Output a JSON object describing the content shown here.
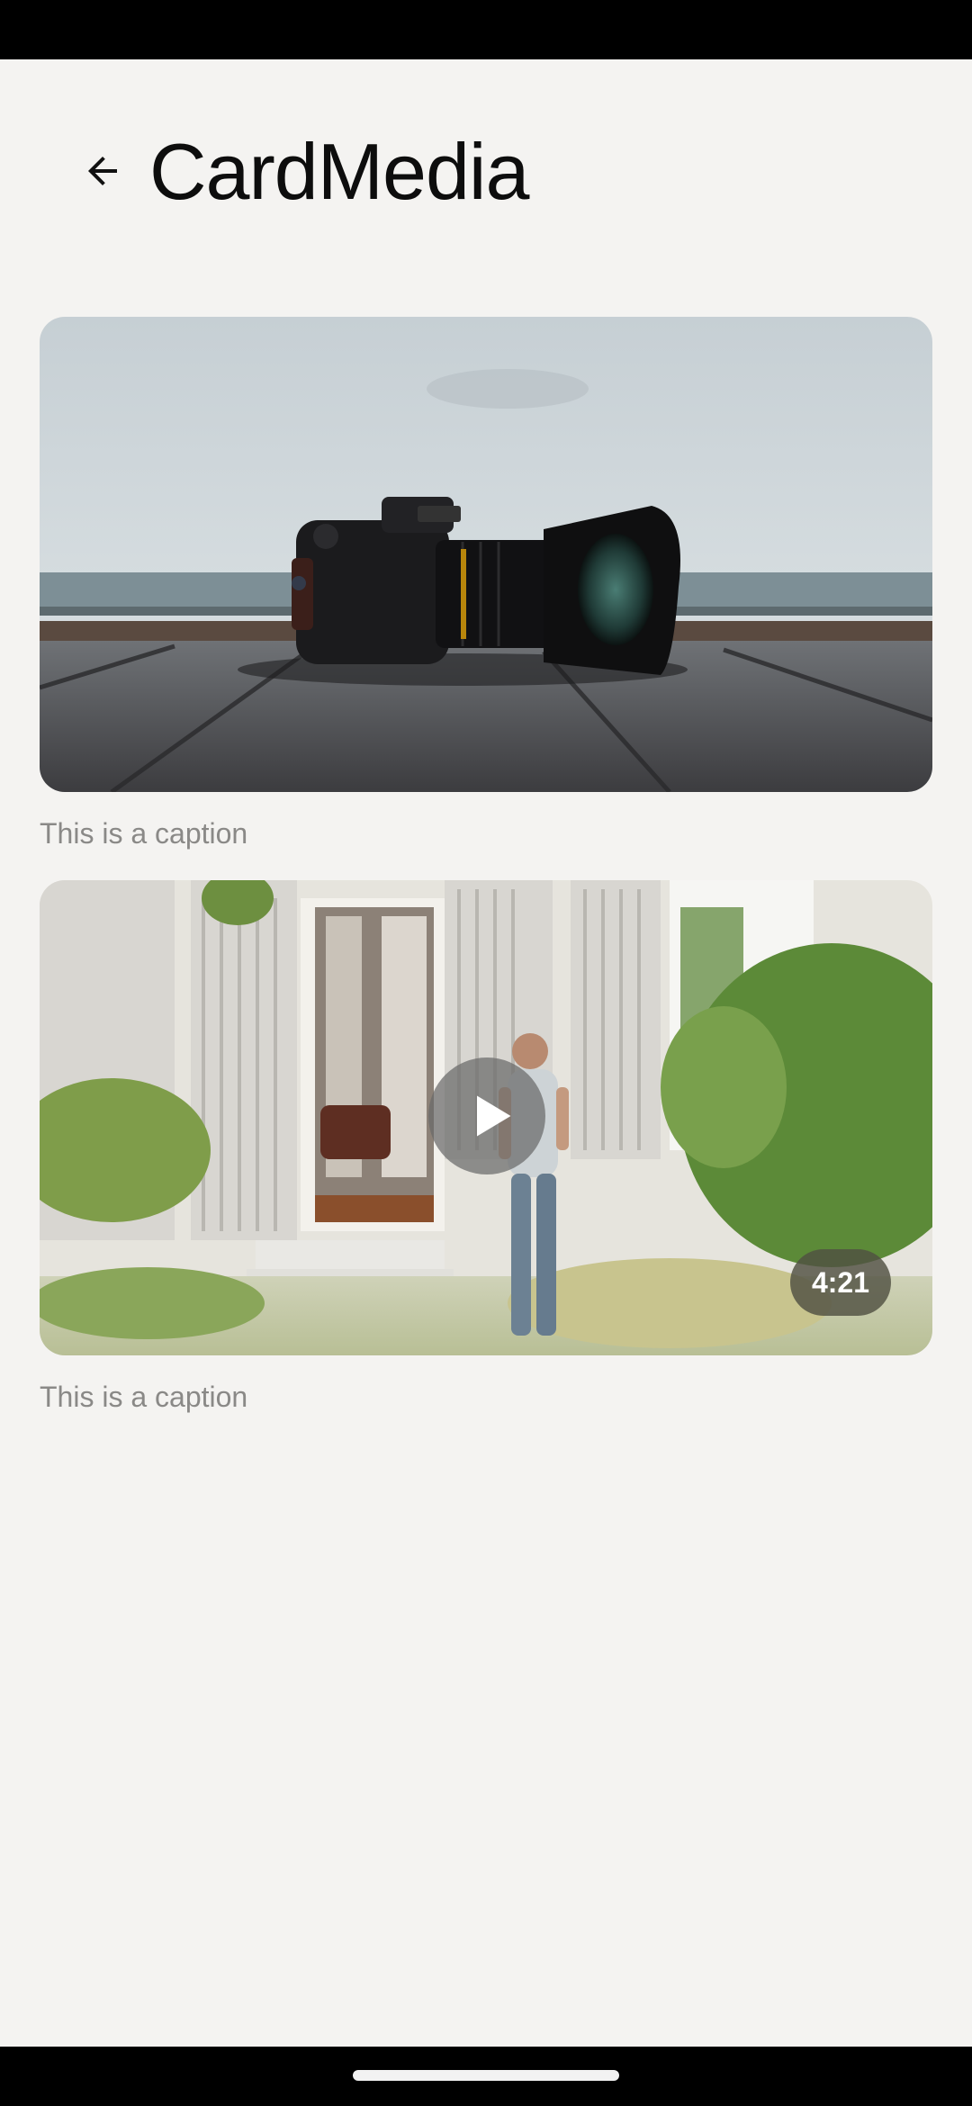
{
  "header": {
    "title": "CardMedia",
    "back_icon": "arrow-back-icon"
  },
  "cards": [
    {
      "media_type": "image",
      "caption": "This is a caption"
    },
    {
      "media_type": "video",
      "caption": "This is a caption",
      "duration": "4:21",
      "play_icon": "play-icon"
    }
  ],
  "colors": {
    "background": "#f4f3f1",
    "caption": "#8a8987",
    "system_bars": "#000000"
  }
}
